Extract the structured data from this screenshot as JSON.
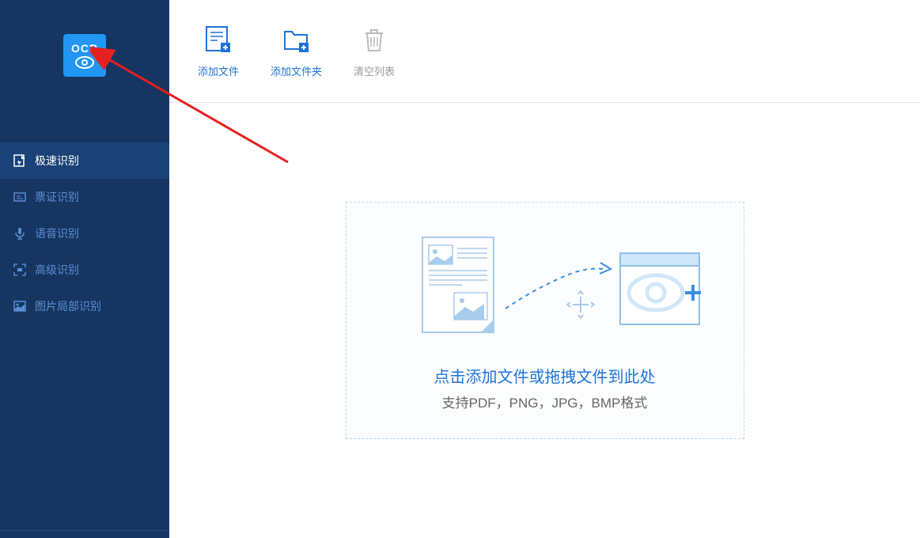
{
  "logo": {
    "text": "OCR"
  },
  "sidebar": {
    "items": [
      {
        "label": "极速识别"
      },
      {
        "label": "票证识别"
      },
      {
        "label": "语音识别"
      },
      {
        "label": "高级识别"
      },
      {
        "label": "图片局部识别"
      }
    ]
  },
  "toolbar": {
    "add_file_label": "添加文件",
    "add_folder_label": "添加文件夹",
    "clear_list_label": "清空列表"
  },
  "dropzone": {
    "title": "点击添加文件或拖拽文件到此处",
    "subtitle": "支持PDF，PNG，JPG，BMP格式"
  }
}
